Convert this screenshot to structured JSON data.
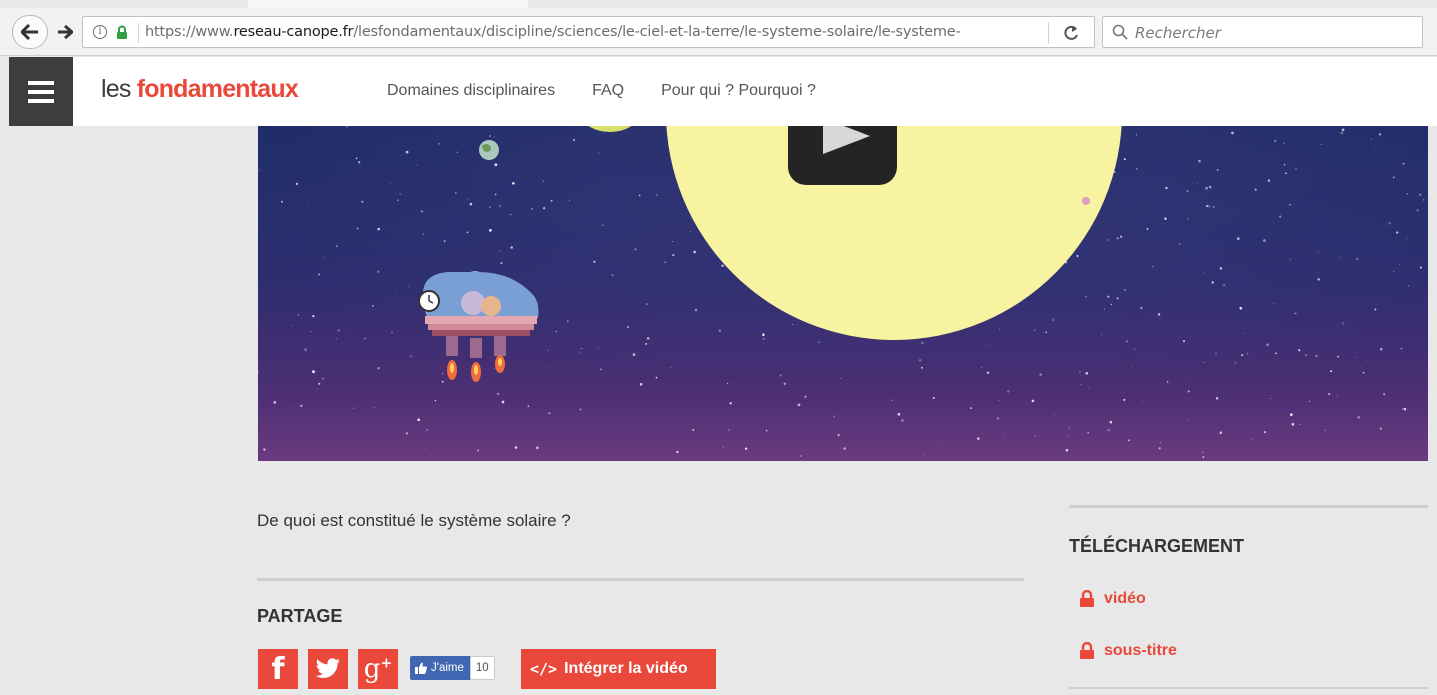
{
  "browser": {
    "url_prefix": "https://www.",
    "url_domain": "reseau-canope.fr",
    "url_path": "/lesfondamentaux/discipline/sciences/le-ciel-et-la-terre/le-systeme-solaire/le-systeme-",
    "search_placeholder": "Rechercher"
  },
  "header": {
    "logo_prefix": "les ",
    "logo_brand": "fondamentaux",
    "nav": [
      "Domaines disciplinaires",
      "FAQ",
      "Pour qui ? Pourquoi ?"
    ]
  },
  "main": {
    "question": "De quoi est constitué le système solaire ?",
    "partage_title": "PARTAGE",
    "like_label": "J'aime",
    "like_count": "10",
    "embed_label": "Intégrer la vidéo",
    "embed_code_glyph": "</>"
  },
  "sidebar": {
    "title": "TÉLÉCHARGEMENT",
    "downloads": [
      "vidéo",
      "sous-titre"
    ]
  },
  "colors": {
    "accent": "#e9483a",
    "menu_bg": "#3d3d3d",
    "facebook_like": "#4267b2",
    "sun": "#f7f3a0",
    "page_bg": "#e8e8e8"
  }
}
